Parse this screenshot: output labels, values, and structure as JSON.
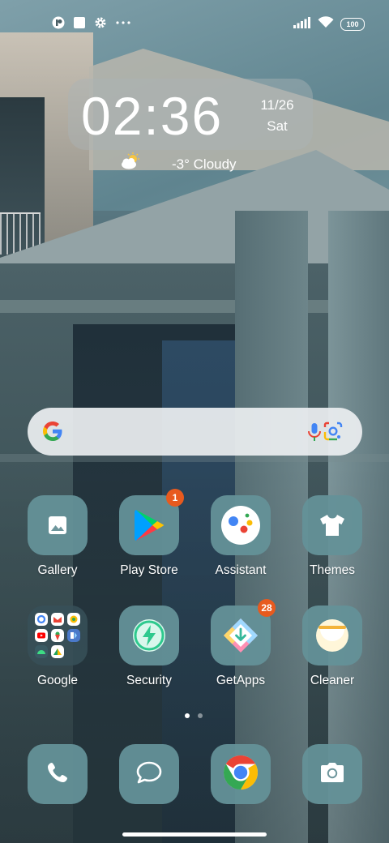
{
  "status_bar": {
    "left_icons": [
      "app-notification-icon",
      "square-icon",
      "settings-gear-icon",
      "more-dots-icon"
    ],
    "right_icons": [
      "signal-icon",
      "wifi-icon",
      "battery-icon"
    ],
    "battery_level": "100"
  },
  "clock_widget": {
    "time": "02:36",
    "date": "11/26",
    "day": "Sat",
    "weather_icon": "partly-cloudy-icon",
    "weather": "-3° Cloudy"
  },
  "search_bar": {
    "logo": "google-g-icon",
    "mic_icon": "microphone-icon",
    "lens_icon": "google-lens-icon"
  },
  "apps": [
    {
      "label": "Gallery",
      "icon": "gallery-icon"
    },
    {
      "label": "Play Store",
      "icon": "play-store-icon",
      "badge": "1"
    },
    {
      "label": "Assistant",
      "icon": "assistant-icon"
    },
    {
      "label": "Themes",
      "icon": "themes-shirt-icon"
    },
    {
      "label": "Google",
      "icon": "google-folder-icon"
    },
    {
      "label": "Security",
      "icon": "security-icon"
    },
    {
      "label": "GetApps",
      "icon": "getapps-icon",
      "badge": "28"
    },
    {
      "label": "Cleaner",
      "icon": "cleaner-icon"
    }
  ],
  "page_indicator": {
    "pages": 2,
    "current": 1
  },
  "dock": [
    {
      "icon": "phone-icon"
    },
    {
      "icon": "messages-icon"
    },
    {
      "icon": "chrome-icon"
    },
    {
      "icon": "camera-icon"
    }
  ],
  "colors": {
    "icon_tile": "#6e969c",
    "badge": "#e85a1e"
  }
}
